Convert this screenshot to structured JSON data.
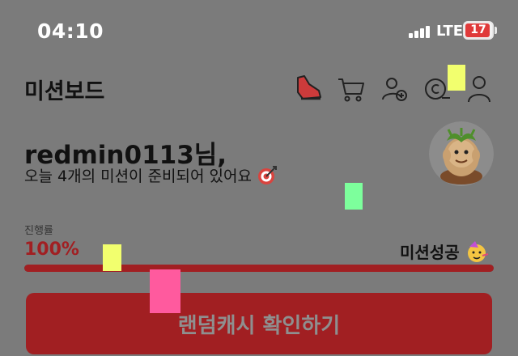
{
  "status": {
    "time": "04:10",
    "network": "LTE",
    "battery": "17",
    "battery_level": 0.17
  },
  "header": {
    "title": "미션보드",
    "icons": [
      "shoe-icon",
      "cart-icon",
      "add-friend-icon",
      "cash-icon",
      "profile-icon"
    ]
  },
  "greeting": {
    "name": "redmin0113님,",
    "subtitle": "오늘 4개의 미션이 준비되어 있어요"
  },
  "progress": {
    "label": "진행률",
    "value": "100%",
    "fraction": 1.0,
    "status": "미션성공"
  },
  "cta": {
    "label": "랜덤캐시 확인하기"
  },
  "colors": {
    "accent": "#a11f22",
    "overlay": "#7b7b7b",
    "marker_yellow": "#f2ff6e",
    "marker_green": "#7dff9c",
    "marker_pink": "#ff5a9e"
  }
}
